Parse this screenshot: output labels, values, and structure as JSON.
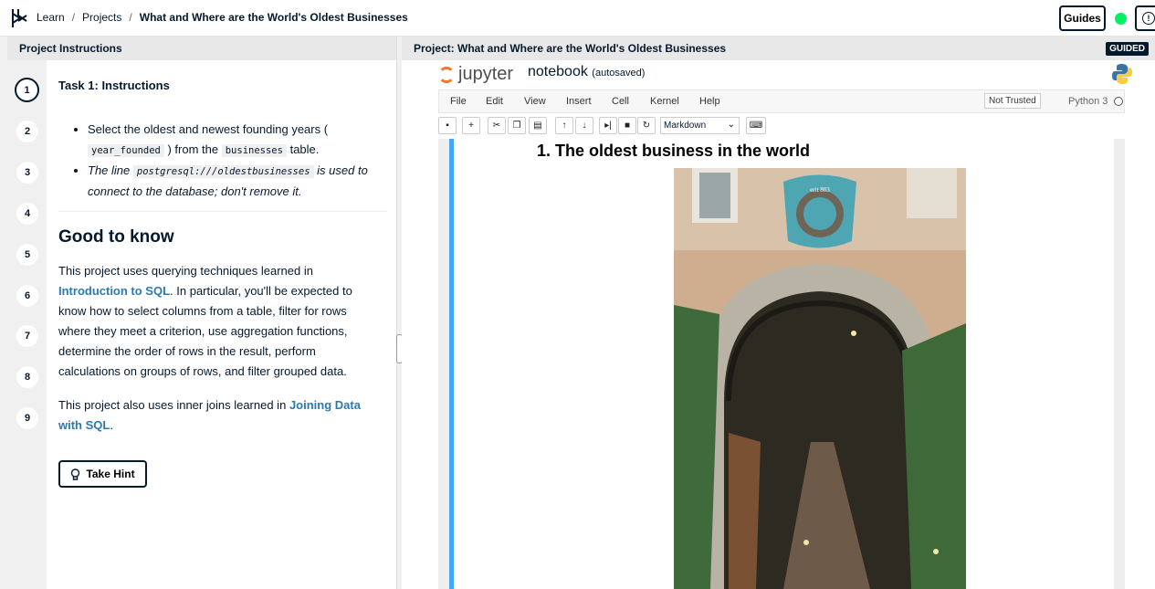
{
  "breadcrumb": {
    "learn": "Learn",
    "projects": "Projects",
    "current": "What and Where are the World's Oldest Businesses",
    "sep": "/"
  },
  "header": {
    "guides": "Guides",
    "info": "!"
  },
  "left": {
    "header": "Project Instructions",
    "steps": [
      "1",
      "2",
      "3",
      "4",
      "5",
      "6",
      "7",
      "8",
      "9"
    ],
    "task_title": "Task 1: Instructions",
    "b1_a": "Select the oldest and newest founding years (",
    "b1_code1": "year_founded",
    "b1_b": ") from the",
    "b1_code2": "businesses",
    "b1_c": "table.",
    "b2_a": "The line",
    "b2_code": "postgresql:///oldestbusinesses",
    "b2_b": "is used to connect to the database; don't remove it.",
    "good_to_know": "Good to know",
    "p1_a": "This project uses querying techniques learned in",
    "p1_link": "Introduction to SQL",
    "p1_b": ". In particular, you'll be expected to know how to select columns from a table, filter for rows where they meet a criterion, use aggregation functions, determine the order of rows in the result, perform calculations on groups of rows, and filter grouped data.",
    "p2_a": "This project also uses inner joins learned in",
    "p2_link": "Joining Data with SQL",
    "p2_b": ".",
    "hint": "Take Hint"
  },
  "right": {
    "header": "Project: What and Where are the World's Oldest Businesses",
    "badge": "GUIDED",
    "jupyter": "jupyter",
    "notebook": "notebook",
    "autosaved": "(autosaved)",
    "menu": [
      "File",
      "Edit",
      "View",
      "Insert",
      "Cell",
      "Kernel",
      "Help"
    ],
    "trusted": "Not Trusted",
    "kernel": "Python 3",
    "cell_type": "Markdown",
    "cell_heading": "1. The oldest business in the world",
    "sign_text": "erit 803"
  }
}
